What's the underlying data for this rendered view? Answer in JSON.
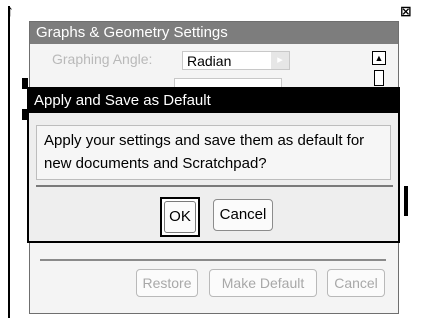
{
  "screen": {
    "left_glyph": "↑",
    "right_glyph": "⊠"
  },
  "settings": {
    "title": "Graphs & Geometry Settings",
    "graphing_angle_label": "Graphing Angle:",
    "graphing_angle_value": "Radian",
    "buttons": {
      "restore": "Restore",
      "make_default": "Make Default",
      "cancel": "Cancel"
    }
  },
  "dialog": {
    "title": "Apply and Save as Default",
    "message": "Apply your settings and save them as default for new documents and Scratchpad?",
    "ok_label": "OK",
    "cancel_label": "Cancel"
  }
}
